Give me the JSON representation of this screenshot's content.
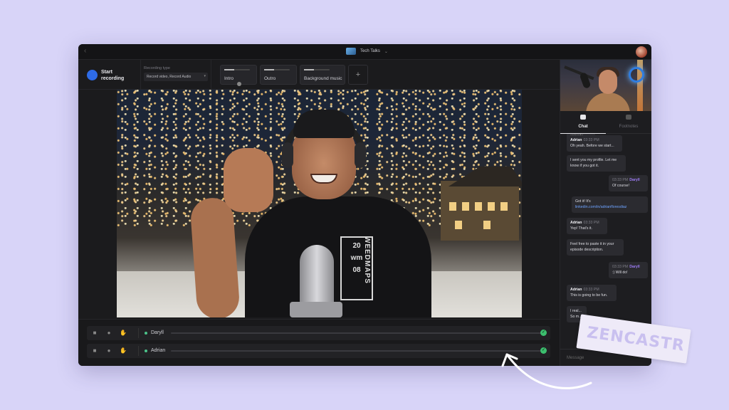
{
  "window": {
    "title": "Tech Talks"
  },
  "toolbar": {
    "record_label": "Start recording",
    "recording_type_label": "Recording type",
    "recording_type_value": "Record video, Record Audio",
    "clips": [
      {
        "label": "Intro"
      },
      {
        "label": "Outro"
      },
      {
        "label": "Background music"
      }
    ],
    "add_label": "+"
  },
  "tracks": [
    {
      "name": "Daryll"
    },
    {
      "name": "Adrian"
    }
  ],
  "shirt_text": {
    "top": "20",
    "middle": "wm",
    "bottom": "08",
    "side": "WEEDMAPS"
  },
  "sidebar": {
    "tabs": [
      {
        "label": "Chat"
      },
      {
        "label": "Footnotes"
      }
    ],
    "messages": [
      {
        "author": "Adrian",
        "time": "03:33 PM",
        "text": "Oh yeah. Before we start..."
      },
      {
        "author": "",
        "time": "",
        "text": "I sent you my profile. Let me know if you got it."
      },
      {
        "author": "Daryll",
        "time": "03:33 PM",
        "text": "Of course!"
      },
      {
        "author": "",
        "time": "",
        "text": "Got it! It's",
        "link": "linkedin.com/in/adrianfloresdiaz"
      },
      {
        "author": "Adrian",
        "time": "03:33 PM",
        "text": "Yep! That's it."
      },
      {
        "author": "",
        "time": "",
        "text": "Feel free to paste it in your episode description."
      },
      {
        "author": "Daryll",
        "time": "03:33 PM",
        "text": ":) Will do!"
      },
      {
        "author": "Adrian",
        "time": "03:33 PM",
        "text": "This is going to be fun."
      },
      {
        "author": "",
        "time": "",
        "text": "I real... So m..."
      }
    ],
    "message_placeholder": "Message"
  },
  "brand": {
    "logo_text": "ZENCASTR"
  },
  "colors": {
    "background": "#d8d4f8",
    "app_bg": "#1b1b1d",
    "record_button": "#2e6be6",
    "status_green": "#3cbf6e",
    "daryll_name": "#9d7cf5",
    "link": "#6ea3ff"
  },
  "icons": [
    "back-arrow-icon",
    "chevron-down-icon",
    "camera-icon",
    "mic-icon",
    "hand-icon",
    "check-icon",
    "chat-icon",
    "footnotes-icon",
    "plus-icon"
  ]
}
